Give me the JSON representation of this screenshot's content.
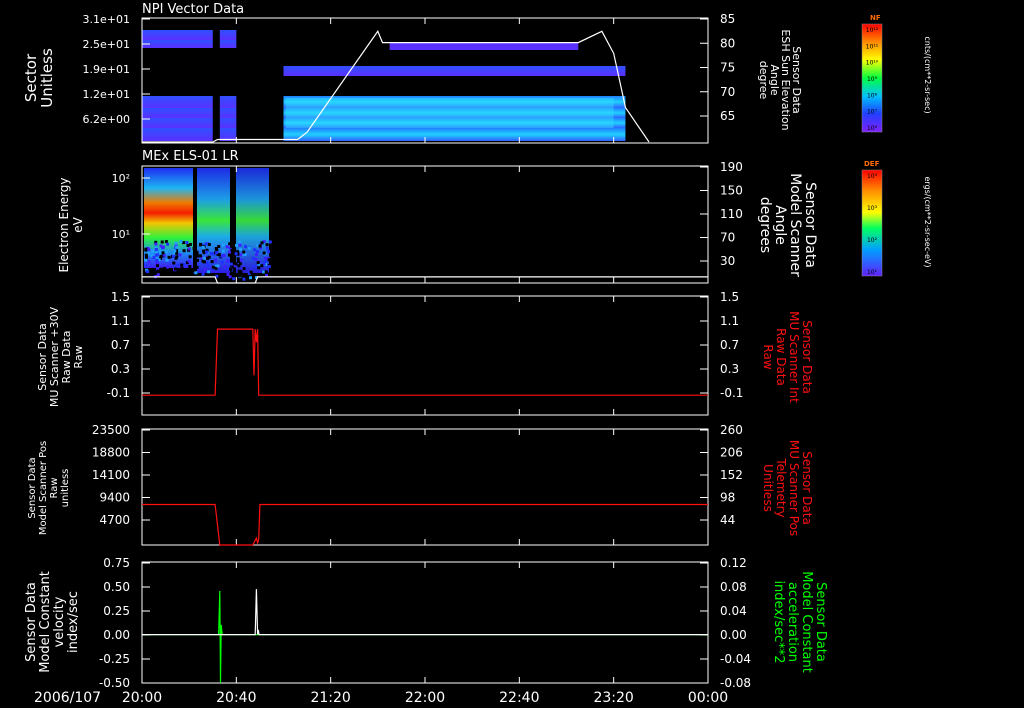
{
  "colors": {
    "background": "#000000",
    "foreground": "#ffffff",
    "red_series": "#ff1010",
    "green_series": "#00ff00"
  },
  "date_label": "2006/107",
  "x_axis": {
    "start": "20:00",
    "end": "00:00",
    "tick_labels": [
      "20:00",
      "20:40",
      "21:20",
      "22:00",
      "22:40",
      "23:20",
      "00:00"
    ],
    "range_minutes": [
      0,
      240
    ]
  },
  "colorbars": [
    {
      "title": "NF",
      "unit_label": "cnts/(cm**2-sr-sec)",
      "tick_labels": [
        "10¹²",
        "10¹¹",
        "10¹⁰",
        "10⁹",
        "10⁸",
        "10⁷",
        "10⁶"
      ]
    },
    {
      "title": "DEF",
      "unit_label": "ergs/(cm**2-sr-sec-eV)",
      "tick_labels": [
        "10⁴",
        "10³",
        "10²",
        "10¹"
      ]
    }
  ],
  "chart_data": [
    {
      "type": "heatmap",
      "title": "NPI Vector Data",
      "ylabel": [
        "Sector",
        "Unitless"
      ],
      "yticks": [
        "3.1e+01",
        "2.5e+01",
        "1.9e+01",
        "1.2e+01",
        "6.2e+00"
      ],
      "right_ylabel": [
        "Sensor Data",
        "ESH Sun Elevation",
        "Angle",
        "degree"
      ],
      "right_yticks": [
        "85",
        "80",
        "75",
        "70",
        "65"
      ],
      "right_ylim": [
        60,
        85
      ],
      "overlay": {
        "name": "ESH Sun Elevation Angle",
        "x_minutes": [
          0,
          30,
          32,
          33,
          35,
          60,
          66,
          70,
          100,
          102,
          185,
          195,
          200,
          205,
          215
        ],
        "y": [
          60,
          60,
          60.5,
          60.5,
          60.5,
          60.5,
          60.5,
          62,
          82.5,
          80.2,
          80.2,
          82.5,
          78,
          67,
          60
        ]
      },
      "bands": [
        {
          "x_from": 0,
          "x_to": 30,
          "rows": [
            1,
            2,
            4,
            5,
            6,
            7
          ]
        },
        {
          "x_from": 33,
          "x_to": 40,
          "rows": [
            1,
            2,
            4,
            5,
            6,
            7
          ]
        },
        {
          "x_from": 60,
          "x_to": 205,
          "rows": [
            3,
            4,
            5,
            6,
            7
          ]
        }
      ]
    },
    {
      "type": "heatmap",
      "title": "MEx ELS-01 LR",
      "ylabel": [
        "Electron Energy",
        "eV"
      ],
      "yticks": [
        "10²",
        "10¹"
      ],
      "right_ylabel": [
        "Sensor Data",
        "Model Scanner",
        "Angle",
        "degrees"
      ],
      "right_yticks": [
        "190",
        "150",
        "110",
        "70",
        "30"
      ],
      "right_ylim": [
        0,
        190
      ],
      "overlay": {
        "name": "Model Scanner Angle",
        "x_minutes": [
          0,
          31,
          32,
          48,
          49,
          240
        ],
        "y": [
          10,
          10,
          0,
          0,
          10,
          10
        ]
      }
    },
    {
      "type": "line",
      "ylabel": [
        "Sensor Data",
        "MU Scanner +30V",
        "Raw Data",
        "Raw"
      ],
      "yticks": [
        "1.5",
        "1.1",
        "0.7",
        "0.3",
        "-0.1"
      ],
      "ylim": [
        -0.3,
        1.5
      ],
      "right_ylabel": [
        "Sensor Data",
        "MU Scanner Int",
        "Raw Data",
        "Raw"
      ],
      "right_yticks": [
        "1.5",
        "1.1",
        "0.7",
        "0.3",
        "-0.1"
      ],
      "series": [
        {
          "color": "red",
          "x_minutes": [
            0,
            31,
            32,
            47,
            47.5,
            48,
            48.5,
            49,
            49.5,
            240
          ],
          "y": [
            0.0,
            0.0,
            1.0,
            1.0,
            0.3,
            1.0,
            0.8,
            1.0,
            0.0,
            0.0
          ]
        }
      ]
    },
    {
      "type": "line",
      "ylabel": [
        "Sensor Data",
        "Model Scanner Pos",
        "Raw",
        "unitless"
      ],
      "yticks": [
        "23500",
        "18800",
        "14100",
        "9400",
        "4700"
      ],
      "ylim": [
        0,
        23500
      ],
      "right_ylabel": [
        "Sensor Data",
        "MU Scanner Pos",
        "Telemetry",
        "Unitless"
      ],
      "right_yticks": [
        "260",
        "206",
        "152",
        "98",
        "44"
      ],
      "series": [
        {
          "color": "red",
          "x_minutes": [
            0,
            31,
            33,
            47,
            48.5,
            49,
            49.5,
            50,
            51,
            240
          ],
          "y": [
            8200,
            8200,
            0,
            0,
            1400,
            400,
            1200,
            8200,
            8200,
            8200
          ]
        }
      ]
    },
    {
      "type": "line",
      "ylabel": [
        "Sensor Data",
        "Model Constant",
        "velocity",
        "index/sec"
      ],
      "yticks": [
        "0.75",
        "0.50",
        "0.25",
        "0.00",
        "-0.25",
        "-0.50"
      ],
      "ylim": [
        -0.5,
        0.75
      ],
      "right_ylabel": [
        "Sensor Data",
        "Model Constant",
        "acceleration",
        "index/sec**2"
      ],
      "right_yticks": [
        "0.12",
        "0.08",
        "0.04",
        "0.00",
        "-0.04",
        "-0.08"
      ],
      "series": [
        {
          "color": "green",
          "x_minutes": [
            0,
            32.5,
            33,
            33.3,
            33.6,
            34,
            240
          ],
          "y": [
            0,
            0,
            0.45,
            -0.5,
            0.1,
            0,
            0
          ]
        },
        {
          "color": "white",
          "x_minutes": [
            0,
            48,
            48.5,
            49,
            49.3,
            49.6,
            240
          ],
          "y": [
            0,
            0,
            0.47,
            0.0,
            0.05,
            0,
            0
          ]
        }
      ]
    }
  ]
}
